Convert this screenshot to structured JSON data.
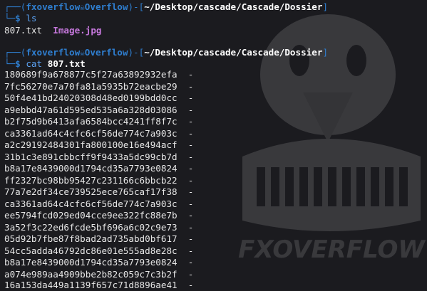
{
  "prompt1": {
    "user": "fxoverflow",
    "host_glyph": "☠",
    "host": "Overflow",
    "path": "~/Desktop/cascade/Cascade/Dossier",
    "command": "ls"
  },
  "ls_output": {
    "file1": "807.txt",
    "file2": "Image.jpg"
  },
  "prompt2": {
    "user": "fxoverflow",
    "host_glyph": "☠",
    "host": "Overflow",
    "path": "~/Desktop/cascade/Cascade/Dossier",
    "command": "cat",
    "argument": "807.txt"
  },
  "hash_lines": [
    "180689f9a678877c5f27a63892932efa  -",
    "7fc56270e7a70fa81a5935b72eacbe29  -",
    "50f4e41bd24020308d48ed0199bdd0cc  -",
    "a9ebbd47a61d595ed535a6a328d03086  -",
    "b2f75d9b6413afa6584bcc4241ff8f7c  -",
    "ca3361ad64c4cfc6cf56de774c7a903c  -",
    "a2c29192484301fa800100e16e494acf  -",
    "31b1c3e891cbbcff9f9433a5dc99cb7d  -",
    "b8a17e8439000d1794cd35a7793e0824  -",
    "ff2327bc98bb95427c231166c6bbcb22  -",
    "77a7e2df34ce739525ece765caf17f38  -",
    "ca3361ad64c4cfc6cf56de774c7a903c  -",
    "ee5794fcd029ed04cce9ee322fc88e7b  -",
    "3a52f3c22ed6fcde5bf696a6c02c9e73  -",
    "05d92b7fbe87f8bad2ad735abd0bf617  -",
    "54cc5adda46792dc86e01e555ad8e28c  -",
    "b8a17e8439000d1794cd35a7793e0824  -",
    "a074e989aa4909bbe2b82c059c7c3b2f  -",
    "16a153da449a1139f657c71d8896ae41  -"
  ],
  "watermark": {
    "text": "FXOVERFLOW",
    "icon": "penguin-mascot-icon"
  },
  "colors": {
    "background": "#1b1b1f",
    "prompt_frame": "#2f7fd1",
    "command": "#5aa0f0",
    "image_file": "#c678dd",
    "text": "#e6e6e6"
  }
}
